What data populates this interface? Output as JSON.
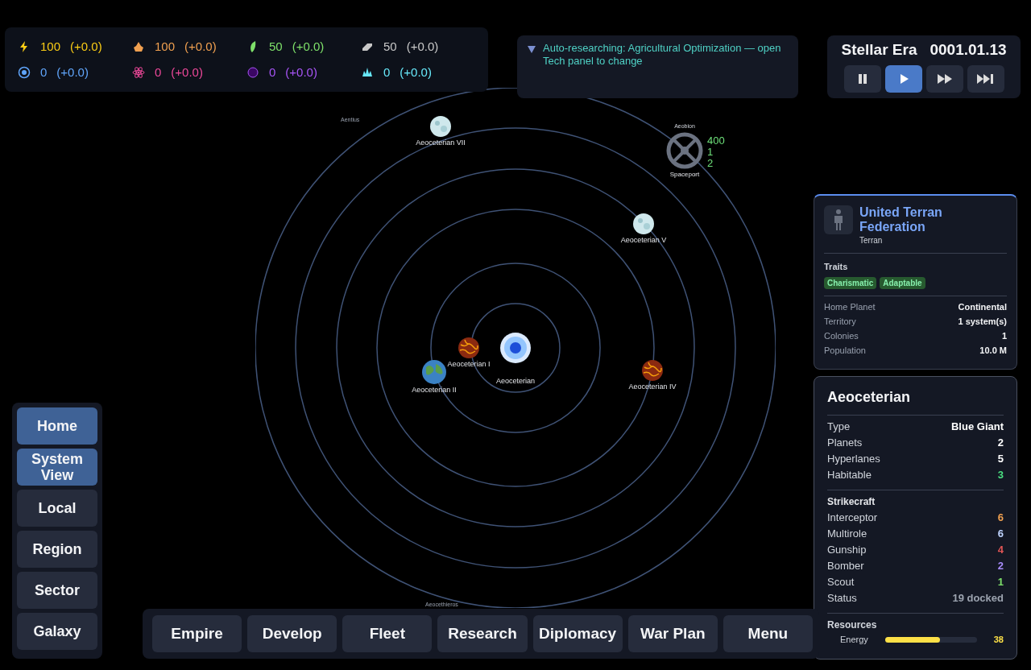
{
  "resources": [
    {
      "kind": "energy",
      "color": "#facc15",
      "amount": "100",
      "delta": "(+0.0)"
    },
    {
      "kind": "minerals",
      "color": "#f0a050",
      "amount": "100",
      "delta": "(+0.0)"
    },
    {
      "kind": "food",
      "color": "#7ee06a",
      "amount": "50",
      "delta": "(+0.0)"
    },
    {
      "kind": "alloys",
      "color": "#c8c8c8",
      "amount": "50",
      "delta": "(+0.0)"
    },
    {
      "kind": "research",
      "color": "#60a5fa",
      "amount": "0",
      "delta": "(+0.0)"
    },
    {
      "kind": "influence",
      "color": "#ec4899",
      "amount": "0",
      "delta": "(+0.0)"
    },
    {
      "kind": "dark",
      "color": "#a855f7",
      "amount": "0",
      "delta": "(+0.0)"
    },
    {
      "kind": "crystal",
      "color": "#67e8f9",
      "amount": "0",
      "delta": "(+0.0)"
    }
  ],
  "notice": {
    "expanded": true,
    "text": "Auto-researching: Agricultural Optimization — open Tech panel to change"
  },
  "clock": {
    "era": "Stellar Era",
    "date": "0001.01.13",
    "controls": [
      {
        "kind": "pause",
        "selected": false
      },
      {
        "kind": "play",
        "selected": true
      },
      {
        "kind": "fast",
        "selected": false
      },
      {
        "kind": "fastest",
        "selected": false
      }
    ]
  },
  "map": {
    "star": {
      "name": "Aeoceterian"
    },
    "planets": [
      {
        "name": "Aeoceterian VII",
        "kind": "ice"
      },
      {
        "name": "Aeoceterian V",
        "kind": "ice"
      },
      {
        "name": "Aeoceterian I",
        "kind": "lava"
      },
      {
        "name": "Aeoceterian II",
        "kind": "earth"
      },
      {
        "name": "Aeoceterian IV",
        "kind": "lava"
      }
    ],
    "spaceport": {
      "label": "Spaceport",
      "system": "Aeobion",
      "stats": [
        "400",
        "1",
        "2"
      ]
    },
    "hyperlanes": [
      "Aentius",
      "Aeocethieros"
    ]
  },
  "view_nav": [
    {
      "label": "Home",
      "selected": true
    },
    {
      "label": "System View",
      "selected": true
    },
    {
      "label": "Local",
      "selected": false
    },
    {
      "label": "Region",
      "selected": false
    },
    {
      "label": "Sector",
      "selected": false
    },
    {
      "label": "Galaxy",
      "selected": false
    }
  ],
  "bottom_nav": [
    "Empire",
    "Develop",
    "Fleet",
    "Research",
    "Diplomacy",
    "War Plan",
    "Menu"
  ],
  "empire": {
    "name": "United Terran Federation",
    "species": "Terran",
    "traits_title": "Traits",
    "traits": [
      "Charismatic",
      "Adaptable"
    ],
    "stats": [
      {
        "label": "Home Planet",
        "value": "Continental"
      },
      {
        "label": "Territory",
        "value": "1 system(s)"
      },
      {
        "label": "Colonies",
        "value": "1"
      },
      {
        "label": "Population",
        "value": "10.0 M"
      }
    ]
  },
  "system": {
    "name": "Aeoceterian",
    "info": [
      {
        "label": "Type",
        "value": "Blue Giant",
        "color": "#ffffff"
      },
      {
        "label": "Planets",
        "value": "2",
        "color": "#ffffff"
      },
      {
        "label": "Hyperlanes",
        "value": "5",
        "color": "#ffffff"
      },
      {
        "label": "Habitable",
        "value": "3",
        "color": "#4ade80"
      }
    ],
    "strikecraft_title": "Strikecraft",
    "strikecraft": [
      {
        "label": "Interceptor",
        "value": "6",
        "color": "#f0a050"
      },
      {
        "label": "Multirole",
        "value": "6",
        "color": "#bfd4ff"
      },
      {
        "label": "Gunship",
        "value": "4",
        "color": "#e05555"
      },
      {
        "label": "Bomber",
        "value": "2",
        "color": "#a78bfa"
      },
      {
        "label": "Scout",
        "value": "1",
        "color": "#7ee06a"
      },
      {
        "label": "Status",
        "value": "19 docked",
        "color": "#9ca3af"
      }
    ],
    "resources_title": "Resources",
    "resources": [
      {
        "label": "Energy",
        "value": "38",
        "level": 0.6
      }
    ]
  }
}
